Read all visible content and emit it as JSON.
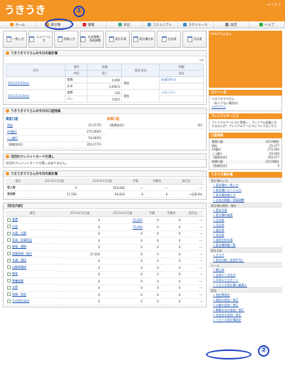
{
  "app": {
    "logo": "うきうき",
    "top_right": "≡ ヘルプ"
  },
  "nav": [
    {
      "label": "ホーム",
      "color": "#f39424"
    },
    {
      "label": "家計簿",
      "color": "#f39424"
    },
    {
      "label": "健康",
      "color": "#d23"
    },
    {
      "label": "日記",
      "color": "#4a8"
    },
    {
      "label": "コミュニティ",
      "color": "#59c"
    },
    {
      "label": "スケジュール",
      "color": "#38c"
    },
    {
      "label": "設定",
      "color": "#888"
    },
    {
      "label": "ヘルプ",
      "color": "#3a3"
    }
  ],
  "tools": [
    "一覧入力",
    "レシート入力",
    "詳細入力",
    "お金移動・残高調整",
    "家計月表",
    "家計簿分析",
    "日計表",
    "月計表"
  ],
  "today": {
    "title": "うきうきママさんの今日の家計簿",
    "count": "2件",
    "headers": [
      "日付",
      "項目",
      "金額",
      "収支/支払",
      "明細",
      "内訳",
      "収入",
      "支出"
    ],
    "rows": [
      {
        "date": "2011/12/14(水)",
        "items": [
          "食費",
          "お米"
        ],
        "amounts": [
          "4,000",
          "4,000/1"
        ],
        "method": "現金",
        "memos": [
          "お米10キロ",
          ""
        ]
      },
      {
        "date": "2011/12/14(水)",
        "items": [
          "食費",
          "パン"
        ],
        "amounts": [
          "120",
          "120/1"
        ],
        "method": "現金",
        "memos": [
          "メロンパン",
          ""
        ]
      }
    ]
  },
  "balance": {
    "title": "うきうきママさんの今日の口座残高",
    "asset_title": "資産口座",
    "debt_title": "負債口座",
    "assets": [
      {
        "name": "現金",
        "value": "25,477円"
      },
      {
        "name": "AA銀行",
        "value": "275,000円"
      },
      {
        "name": "○○銀行",
        "value": "50,000円"
      },
      {
        "name": "【資産合計】",
        "value": "350,477円"
      }
    ],
    "debts": [
      {
        "name": "【負債合計】",
        "value": "0円"
      }
    ]
  },
  "credit": {
    "title": "次回のクレジットカード引落し",
    "text": "次回のクレジットカード引落しはありません。"
  },
  "monthly": {
    "title": "うきうきママさんの今月の家計簿",
    "headers": [
      "項目",
      "2011年11月度",
      "2011年12月度",
      "予算",
      "予算残",
      "前月比"
    ],
    "rows": [
      [
        "収入計",
        "0",
        "550,000",
        "---",
        "---",
        "---"
      ],
      [
        "支出計",
        "27,550",
        "90,620",
        "0",
        "0",
        "+228.9%"
      ]
    ]
  },
  "breakdown": {
    "title": "【収支内訳】",
    "headers": [
      "項目",
      "2011年11月度",
      "2011年12月度",
      "予算",
      "予算残",
      "前月比"
    ],
    "rows": [
      [
        "食費",
        "0",
        "15,620",
        "0",
        "0",
        "---"
      ],
      [
        "住居",
        "0",
        "75,000",
        "0",
        "0",
        "---"
      ],
      [
        "水道・光熱",
        "0",
        "0",
        "0",
        "0",
        "---"
      ],
      [
        "家具・家事用品",
        "0",
        "0",
        "0",
        "0",
        "---"
      ],
      [
        "被服・履物",
        "0",
        "0",
        "0",
        "0",
        "---"
      ],
      [
        "保健医療・衛生",
        "27,550",
        "0",
        "0",
        "0",
        "---"
      ],
      [
        "交通・通信",
        "0",
        "0",
        "0",
        "0",
        "---"
      ],
      [
        "自動車関係",
        "0",
        "0",
        "0",
        "0",
        "---"
      ],
      [
        "教育",
        "0",
        "0",
        "0",
        "0",
        "---"
      ],
      [
        "教養娯楽",
        "0",
        "0",
        "0",
        "0",
        "---"
      ],
      [
        "交際",
        "0",
        "0",
        "0",
        "0",
        "---"
      ],
      [
        "保険・税金",
        "0",
        "0",
        "0",
        "0",
        "---"
      ],
      [
        "その他の支出",
        "0",
        "0",
        "0",
        "0",
        "---"
      ]
    ]
  },
  "side": {
    "ad": "XXSLITの広告を",
    "login": {
      "title": "ログイン名",
      "lines": [
        "うきうきママさん",
        "（本人でない場合は）",
        "ログアウト"
      ]
    },
    "premium": {
      "title": "プレミアムサービス",
      "text": "プレミアムサービスに登録し、プレミアム会員になりませんか？プレミアムサービスについてはこちら"
    },
    "account": {
      "title": "口座残高",
      "head": [
        "資産口座",
        "12/14現在"
      ],
      "rows": [
        [
          "現金",
          "25,477"
        ],
        [
          "AA銀行",
          "275,000"
        ],
        [
          "○○銀行",
          "50,000"
        ],
        [
          "【資産合計】",
          "350,477"
        ]
      ],
      "debt_head": [
        "負債口座",
        "12/14現在"
      ],
      "debt_row": [
        "【負債合計】",
        "0"
      ]
    },
    "menu_title": "うきうき家計簿",
    "groups": [
      {
        "h": "家計簿の入力",
        "items": [
          "家計簿の一覧入力",
          "家計簿レシート入力",
          "家計簿詳細入力",
          "お金の移動・残高調整"
        ]
      },
      {
        "h": "家計簿の閲覧・集計",
        "items": [
          "家計月表",
          "家計簿の検索",
          "日計表",
          "月計表",
          "週計表",
          "年計表",
          "項目別年計表",
          "家計簿明細一覧"
        ]
      },
      {
        "h": "家計分析",
        "items": [
          "グラフ",
          "家計比較（全国平均）"
        ]
      },
      {
        "h": "ツール",
        "items": [
          "積立表",
          "全体データ出力",
          "CSVエクスポート",
          "うきうき家計簿へ乗換え"
        ]
      },
      {
        "h": "設定",
        "items": [
          "固定費設定",
          "項目の追加・修正",
          "口座の追加・修正",
          "精算方法の追加・修正",
          "お店名の追加・修正",
          "うきうき家計簿設定"
        ]
      }
    ]
  },
  "annotations": {
    "one": "①",
    "two": "②"
  }
}
